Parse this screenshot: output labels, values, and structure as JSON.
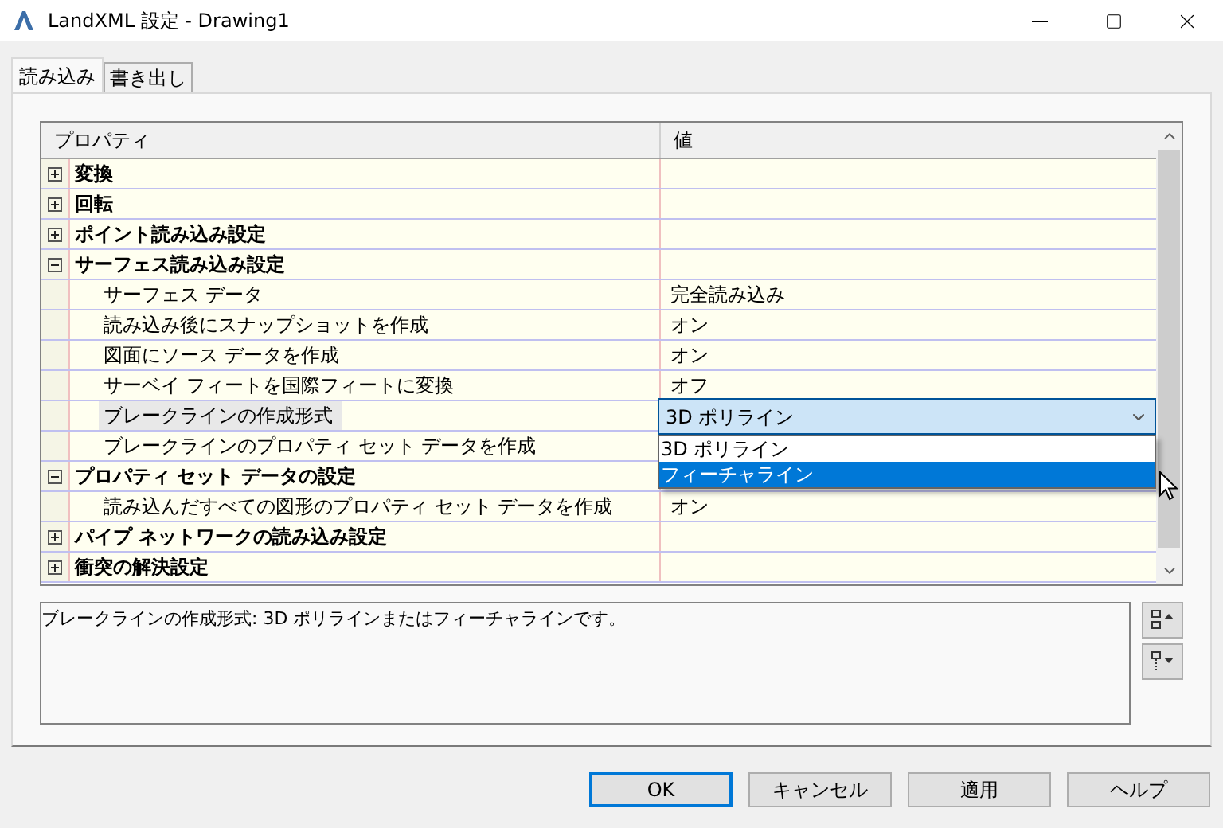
{
  "window": {
    "title": "LandXML 設定 - Drawing1"
  },
  "tabs": [
    {
      "label": "読み込み",
      "selected": true
    },
    {
      "label": "書き出し",
      "selected": false
    }
  ],
  "grid": {
    "columns": [
      "プロパティ",
      "値"
    ],
    "categories": [
      {
        "label": "変換",
        "expanded": false
      },
      {
        "label": "回転",
        "expanded": false
      },
      {
        "label": "ポイント読み込み設定",
        "expanded": false
      },
      {
        "label": "サーフェス読み込み設定",
        "expanded": true,
        "children": [
          {
            "label": "サーフェス データ",
            "value": "完全読み込み",
            "selected": false
          },
          {
            "label": "読み込み後にスナップショットを作成",
            "value": "オン",
            "selected": false
          },
          {
            "label": "図面にソース データを作成",
            "value": "オン",
            "selected": false
          },
          {
            "label": "サーベイ フィートを国際フィートに変換",
            "value": "オフ",
            "selected": false
          },
          {
            "label": "ブレークラインの作成形式",
            "value": "3D ポリライン",
            "selected": true,
            "dropdown": {
              "options": [
                {
                  "label": "3D ポリライン",
                  "selected": false
                },
                {
                  "label": "フィーチャライン",
                  "selected": true
                }
              ]
            }
          },
          {
            "label": "ブレークラインのプロパティ セット データを作成",
            "selected": false
          }
        ]
      },
      {
        "label": "プロパティ セット データの設定",
        "expanded": true,
        "children": [
          {
            "label": "読み込んだすべての図形のプロパティ セット データを作成",
            "value": "オン",
            "selected": false
          }
        ]
      },
      {
        "label": "パイプ ネットワークの読み込み設定",
        "expanded": false
      },
      {
        "label": "衝突の解決設定",
        "expanded": false
      }
    ]
  },
  "description": "ブレークラインの作成形式: 3D ポリラインまたはフィーチャラインです。",
  "buttons": [
    {
      "label": "OK",
      "default": true
    },
    {
      "label": "キャンセル",
      "default": false
    },
    {
      "label": "適用",
      "default": false
    },
    {
      "label": "ヘルプ",
      "default": false
    }
  ]
}
